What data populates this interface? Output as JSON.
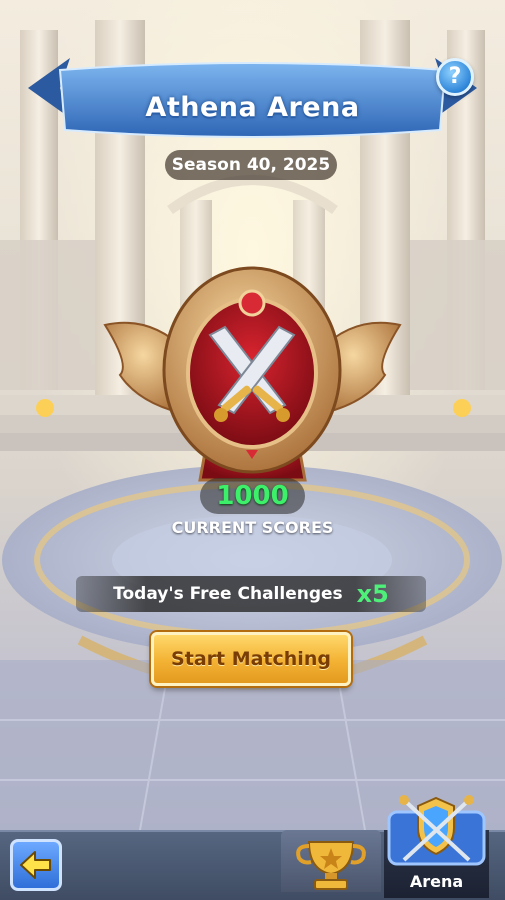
{
  "header": {
    "title": "Athena Arena",
    "help_symbol": "?",
    "help_icon": "question-icon"
  },
  "season": "Season 40, 2025",
  "emblem": {
    "icon": "crossed-swords-icon"
  },
  "score": {
    "value": "1000",
    "label": "CURRENT SCORES"
  },
  "challenges": {
    "label": "Today's Free Challenges",
    "count": "x5"
  },
  "actions": {
    "start_label": "Start Matching"
  },
  "nav": {
    "back_icon": "arrow-left-icon",
    "trophy_icon": "trophy-icon",
    "arena_icon": "arena-shield-icon",
    "arena_label": "Arena",
    "active_tab": "Arena"
  },
  "colors": {
    "score_green": "#3df06a",
    "button_gold": "#f3b233",
    "banner_blue": "#3e79c6"
  }
}
